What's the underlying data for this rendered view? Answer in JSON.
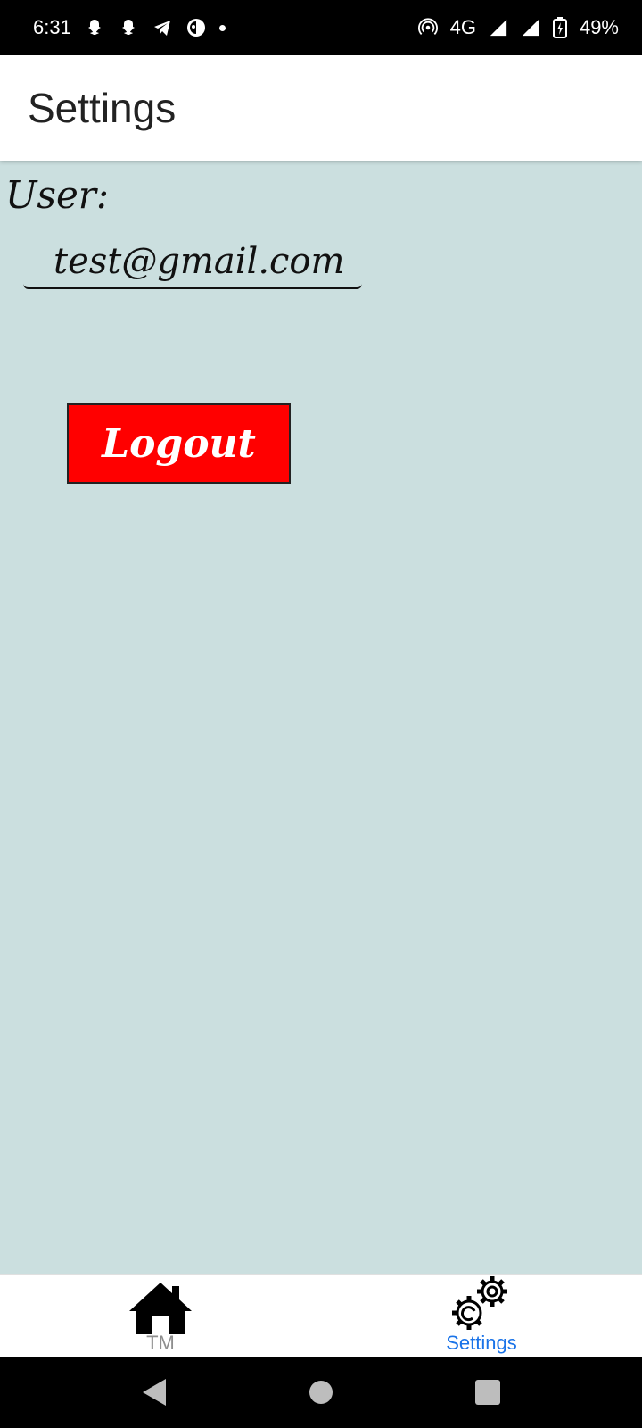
{
  "status_bar": {
    "time": "6:31",
    "network": "4G",
    "battery": "49%",
    "notification_icons": [
      "snapchat-icon",
      "snapchat-icon",
      "telegram-icon",
      "app-icon",
      "dot-icon"
    ],
    "system_icons": [
      "hotspot-icon",
      "signal-icon",
      "signal-icon",
      "battery-charging-icon"
    ]
  },
  "app_bar": {
    "title": "Settings"
  },
  "content": {
    "user_label": "User:",
    "user_email": "test@gmail.com",
    "logout_label": "Logout"
  },
  "bottom_nav": {
    "items": [
      {
        "label": "TM",
        "icon": "home-icon",
        "active": false
      },
      {
        "label": "Settings",
        "icon": "gears-icon",
        "active": true
      }
    ],
    "active_color": "#1a73e8",
    "inactive_color": "#8e8e8e"
  },
  "system_nav": [
    "back-icon",
    "home-circle-icon",
    "recents-icon"
  ],
  "colors": {
    "background": "#cbdfdf",
    "logout_button": "#ff0000"
  }
}
